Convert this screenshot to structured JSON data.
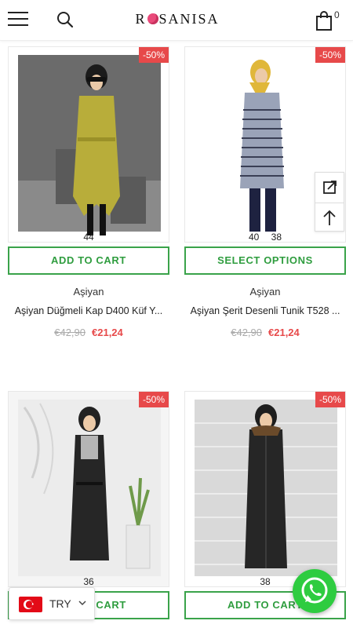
{
  "header": {
    "menu_icon": "hamburger-menu-icon",
    "search_icon": "search-icon",
    "logo_text_left": "R",
    "logo_text_right": "SANISA",
    "cart_icon": "shopping-bag-icon",
    "cart_count": "0"
  },
  "products": [
    {
      "discount": "-50%",
      "sizes": [
        "44"
      ],
      "button": "ADD TO CART",
      "brand": "Aşiyan",
      "title": "Aşiyan Düğmeli Kap D400 Küf Y...",
      "old_price": "€42,90",
      "new_price": "€21,24",
      "image_colors": {
        "background": "#6b6b6b",
        "coat": "#b8ad3a",
        "hijab": "#1b1b1b"
      }
    },
    {
      "discount": "-50%",
      "sizes": [
        "40",
        "38"
      ],
      "button": "SELECT OPTIONS",
      "brand": "Aşiyan",
      "title": "Aşiyan Şerit Desenli Tunik T528 ...",
      "old_price": "€42,90",
      "new_price": "€21,24",
      "image_colors": {
        "background": "#ffffff",
        "tunic": "#9aa3b8",
        "hijab": "#e0b73a"
      }
    },
    {
      "discount": "-50%",
      "sizes": [
        "36"
      ],
      "button": "ADD TO CART",
      "image_colors": {
        "background": "#f0f0f0",
        "coat": "#262626",
        "hijab": "#222222"
      }
    },
    {
      "discount": "-50%",
      "sizes": [
        "38"
      ],
      "button": "ADD TO CART",
      "image_colors": {
        "background": "#d9d9d9",
        "coat": "#262626",
        "hijab": "#1e1e1e"
      }
    }
  ],
  "floating": {
    "expand_icon": "expand-icon",
    "top_icon": "arrow-up-icon"
  },
  "currency": {
    "code": "TRY",
    "flag_icon": "turkey-flag-icon",
    "chevron_icon": "chevron-down-icon"
  },
  "whatsapp_icon": "whatsapp-icon",
  "colors": {
    "accent_green": "#3aa34a",
    "sale_red": "#e7494a"
  }
}
